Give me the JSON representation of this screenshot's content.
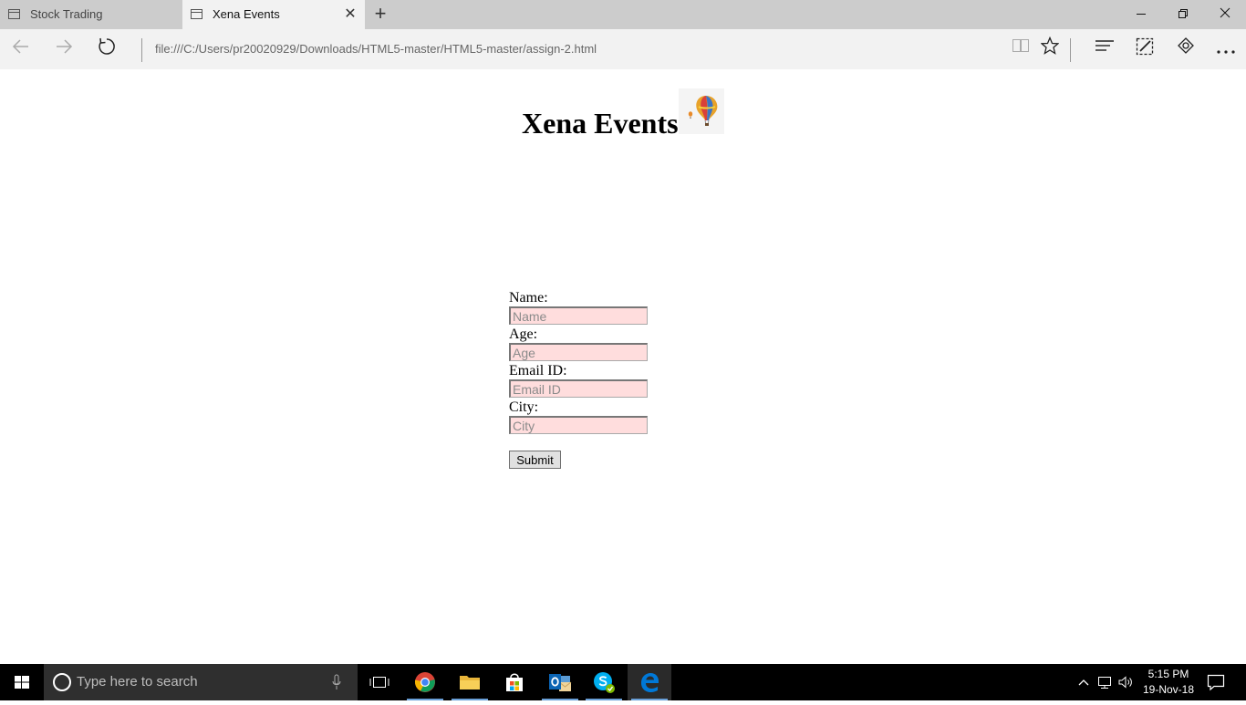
{
  "browser": {
    "tabs": [
      {
        "label": "Stock Trading",
        "active": false
      },
      {
        "label": "Xena Events",
        "active": true
      }
    ],
    "new_tab_symbol": "+",
    "url": "file:///C:/Users/pr20020929/Downloads/HTML5-master/HTML5-master/assign-2.html",
    "icons": [
      "tab-icon",
      "close-icon",
      "back-icon",
      "forward-icon",
      "refresh-icon",
      "reading-view-icon",
      "favorite-star-icon",
      "hub-icon",
      "web-note-icon",
      "share-icon",
      "more-icon",
      "minimize-icon",
      "maximize-icon",
      "window-close-icon"
    ]
  },
  "page": {
    "heading": "Xena Events",
    "image": "hot-air-balloon-icon",
    "form": {
      "fields": [
        {
          "label": "Name:",
          "placeholder": "Name"
        },
        {
          "label": "Age:",
          "placeholder": "Age"
        },
        {
          "label": "Email ID:",
          "placeholder": "Email ID"
        },
        {
          "label": "City:",
          "placeholder": "City"
        }
      ],
      "submit_label": "Submit"
    }
  },
  "taskbar": {
    "search_placeholder": "Type here to search",
    "apps": [
      "task-view-icon",
      "chrome-icon",
      "file-explorer-icon",
      "store-icon",
      "outlook-icon",
      "skype-icon",
      "edge-icon"
    ],
    "clock": {
      "time": "5:15 PM",
      "date": "19-Nov-18"
    }
  },
  "colors": {
    "input_background": "#ffdddd",
    "tab_strip": "#cccccc",
    "toolbar": "#f2f2f2",
    "taskbar": "#000000",
    "edge_blue": "#0078d7"
  }
}
